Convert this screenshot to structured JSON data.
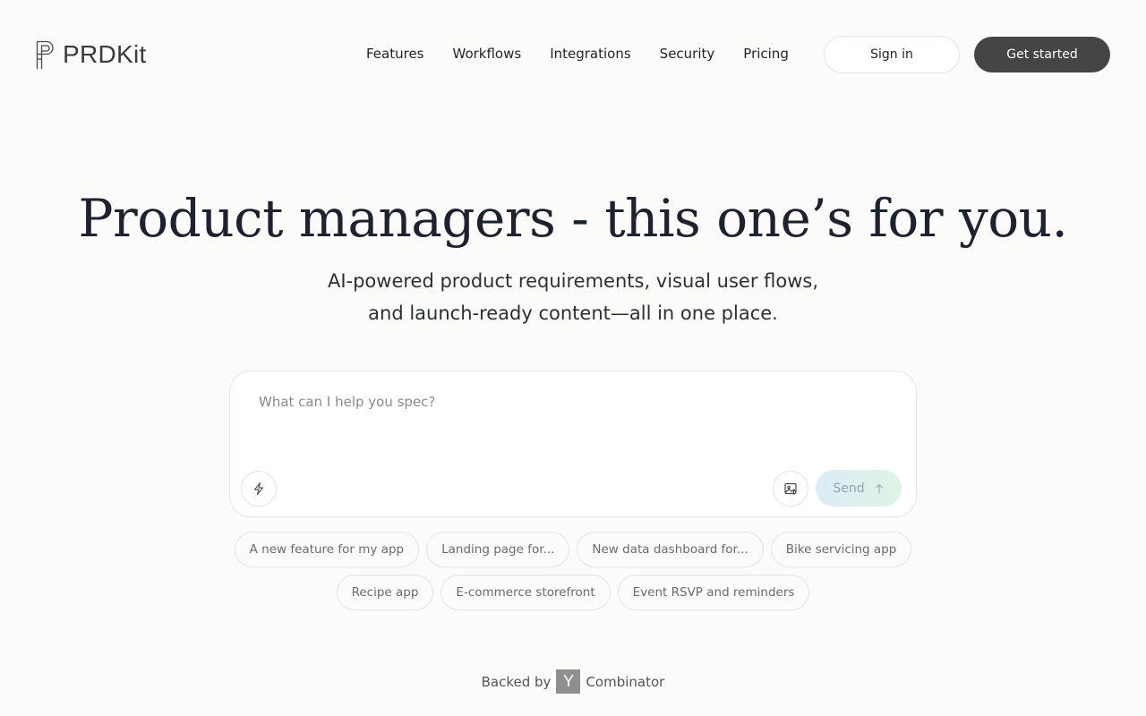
{
  "brand": {
    "name": "PRDKit",
    "logo_icon": "prdkit-logo-icon"
  },
  "nav": {
    "items": [
      {
        "label": "Features"
      },
      {
        "label": "Workflows"
      },
      {
        "label": "Integrations"
      },
      {
        "label": "Security"
      },
      {
        "label": "Pricing"
      }
    ]
  },
  "header": {
    "signin_label": "Sign in",
    "get_started_label": "Get started"
  },
  "hero": {
    "title": "Product managers - this one’s for you.",
    "subtitle_line1": "AI-powered product requirements, visual user flows,",
    "subtitle_line2": "and launch-ready content—all in one place."
  },
  "prompt": {
    "placeholder": "What can I help you spec?",
    "value": "",
    "bolt_icon": "lightning-icon",
    "image_icon": "image-upload-icon",
    "send_label": "Send",
    "send_icon": "arrow-up-icon"
  },
  "suggestions": {
    "row1": [
      {
        "label": "A new feature for my app"
      },
      {
        "label": "Landing page for..."
      },
      {
        "label": "New data dashboard for..."
      },
      {
        "label": "Bike servicing app"
      }
    ],
    "row2": [
      {
        "label": "Recipe app"
      },
      {
        "label": "E-commerce storefront"
      },
      {
        "label": "Event RSVP and reminders"
      }
    ]
  },
  "backed": {
    "prefix": "Backed by",
    "logo_letter": "Y",
    "suffix": "Combinator"
  },
  "colors": {
    "background": "#fbfbf9",
    "primary_button": "#454545",
    "send_gradient_start": "#dcebf7",
    "send_gradient_end": "#def5e4"
  }
}
